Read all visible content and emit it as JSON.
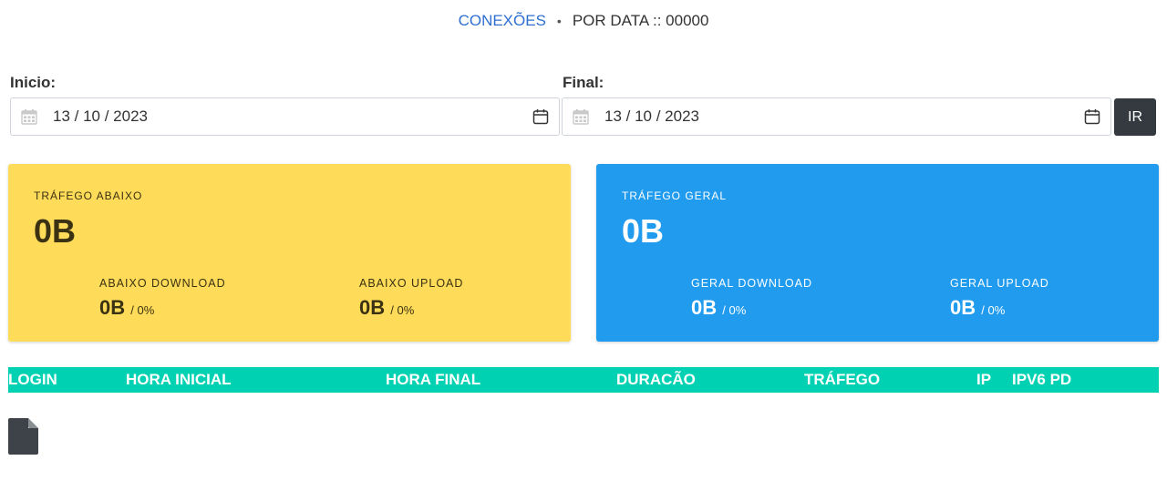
{
  "breadcrumb": {
    "link": "CONEXÕES",
    "separator": "•",
    "current": "POR DATA :: 00000"
  },
  "filters": {
    "start_label": "Inicio:",
    "start_value": "13 / 10 / 2023",
    "end_label": "Final:",
    "end_value": "13 / 10 / 2023",
    "go_label": "IR"
  },
  "cards": {
    "down": {
      "title": "TRÁFEGO ABAIXO",
      "value": "0B",
      "download_label": "ABAIXO DOWNLOAD",
      "download_value": "0B",
      "download_pct": "/ 0%",
      "upload_label": "ABAIXO UPLOAD",
      "upload_value": "0B",
      "upload_pct": "/ 0%",
      "color": "#fedb58"
    },
    "total": {
      "title": "TRÁFEGO GERAL",
      "value": "0B",
      "download_label": "GERAL DOWNLOAD",
      "download_value": "0B",
      "download_pct": "/ 0%",
      "upload_label": "GERAL UPLOAD",
      "upload_value": "0B",
      "upload_pct": "/ 0%",
      "color": "#219bee"
    }
  },
  "table": {
    "columns": [
      "LOGIN",
      "HORA INICIAL",
      "HORA FINAL",
      "DURACÃO",
      "TRÁFEGO",
      "IP",
      "IPV6 PD"
    ],
    "header_color": "#00d1b2"
  },
  "icons": {
    "export": "file-icon",
    "date_prefix": "calendar-grid-icon",
    "date_picker": "calendar-icon"
  }
}
